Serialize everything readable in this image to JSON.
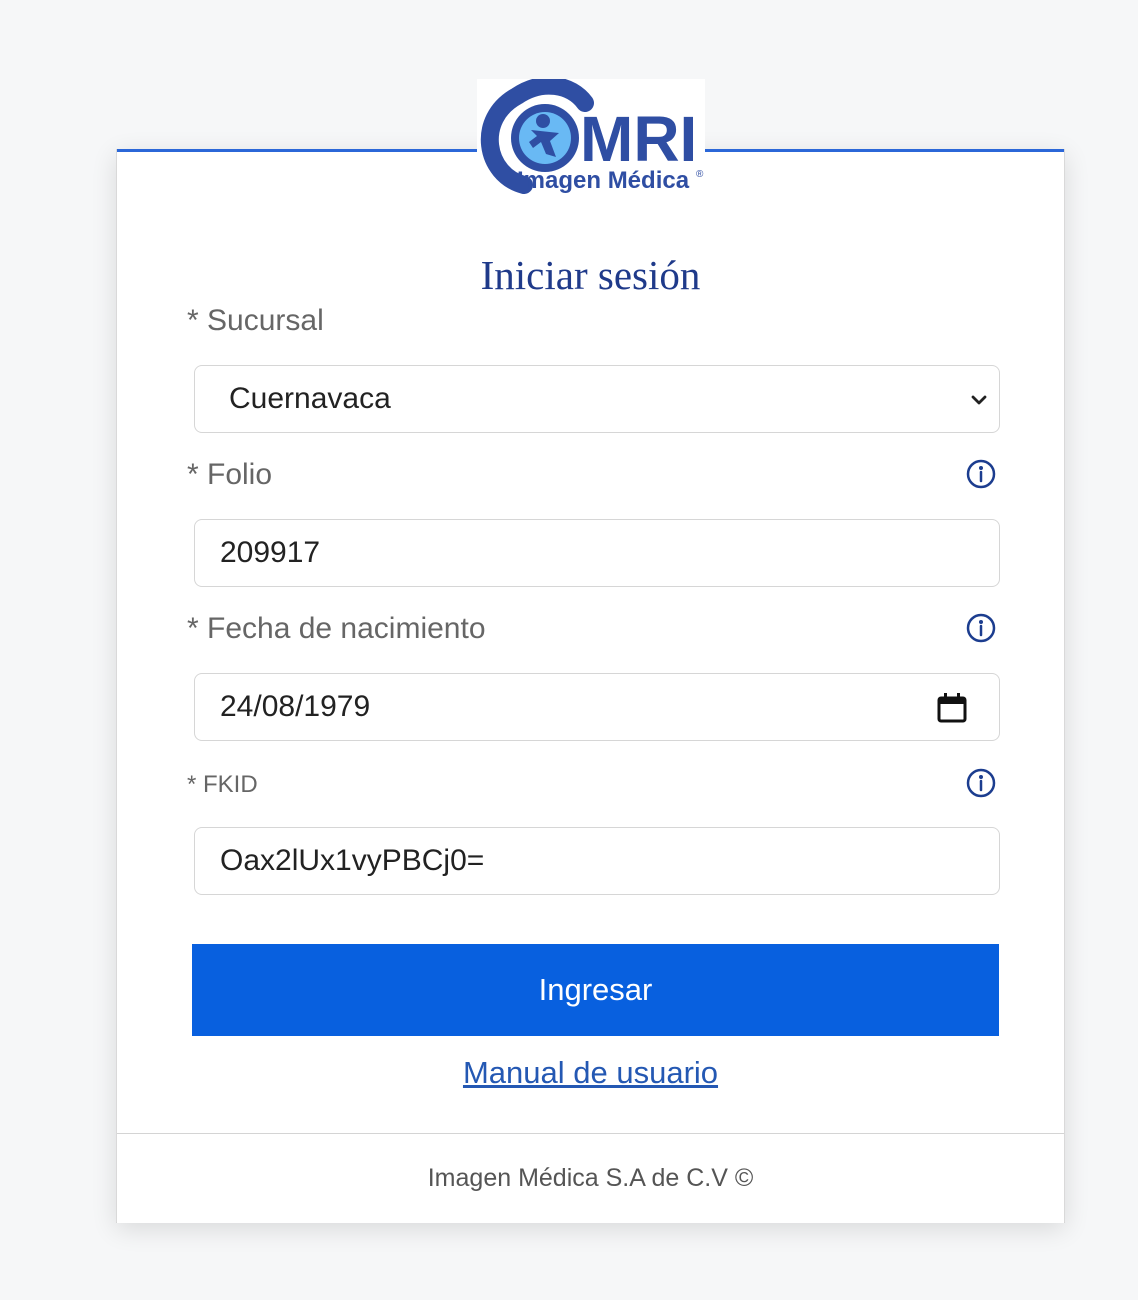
{
  "logo": {
    "brand": "MRI",
    "subtitle": "Imagen Médica",
    "registered": "®",
    "primary_color": "#2f4ea3",
    "accent_color": "#55aef0"
  },
  "form": {
    "title": "Iniciar sesión",
    "sucursal": {
      "label": "* Sucursal",
      "value": "Cuernavaca"
    },
    "folio": {
      "label": "* Folio",
      "value": "209917"
    },
    "fecha": {
      "label": "* Fecha de nacimiento",
      "value": "24/08/1979"
    },
    "fkid": {
      "label": "* FKID",
      "value": "Oax2lUx1vyPBCj0="
    },
    "submit_label": "Ingresar",
    "manual_link": "Manual de usuario"
  },
  "footer": {
    "text": "Imagen Médica S.A de C.V ©"
  },
  "colors": {
    "button": "#0860df",
    "title": "#1f3a8a",
    "link": "#2458b3",
    "top_line": "#2b67d8"
  },
  "icons": {
    "info": "info-icon",
    "dropdown": "chevron-down-icon",
    "calendar": "calendar-icon"
  }
}
